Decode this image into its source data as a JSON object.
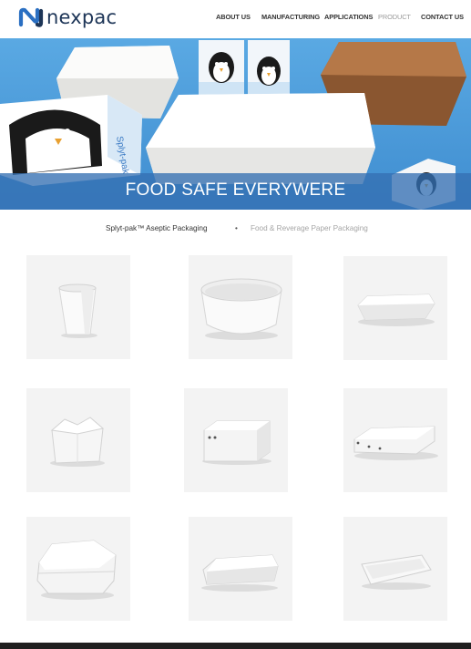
{
  "brand": {
    "name": "nexpac",
    "color": "#1d3557",
    "accent": "#2a6fc2"
  },
  "nav": {
    "items": [
      {
        "label": "ABOUT US",
        "active": false
      },
      {
        "label": "MANUFACTURING",
        "active": false
      },
      {
        "label": "APPLICATIONS",
        "active": false
      },
      {
        "label": "PRODUCT",
        "active": true
      },
      {
        "label": "CONTACT US",
        "active": false
      }
    ]
  },
  "hero": {
    "title": "FOOD SAFE EVERYWERE",
    "carton_text": "Splyt-pak"
  },
  "subnav": {
    "item1": "Splyt-pak™ Aseptic Packaging",
    "separator": "•",
    "item2": "Food & Reverage Paper Packaging"
  },
  "products": [
    {
      "icon": "paper-cup-icon"
    },
    {
      "icon": "paper-bowl-icon"
    },
    {
      "icon": "flat-tray-box-icon"
    },
    {
      "icon": "noodle-box-icon"
    },
    {
      "icon": "lidded-food-box-icon"
    },
    {
      "icon": "flat-pizza-box-icon"
    },
    {
      "icon": "burger-clamshell-icon"
    },
    {
      "icon": "hotdog-clamshell-icon"
    },
    {
      "icon": "open-tray-icon"
    }
  ]
}
